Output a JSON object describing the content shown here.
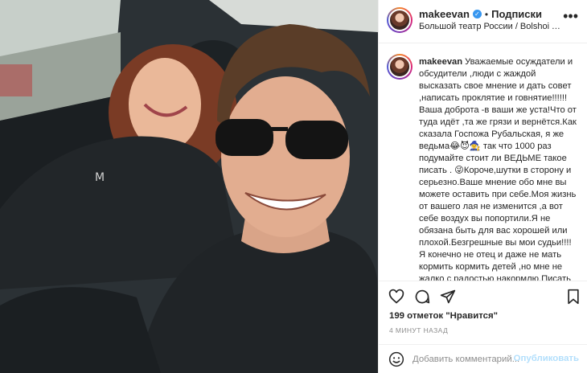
{
  "post": {
    "username": "makeevan",
    "verified_mark": "✓",
    "separator": "•",
    "follow_label": "Подписки",
    "location": "Большой театр России / Bolshoi Theatre Russia",
    "more_icon": "more-horizontal-icon"
  },
  "caption": {
    "username": "makeevan",
    "text": "Уважаемые осуждатели и обсудители ,люди с жаждой высказать свое мнение и дать совет ,написать проклятие и говнятие!!!!!! Ваша доброта -в ваши же уста!Что от туда идёт ,та же грязи и вернётся.Как сказала Госпожа Рубальская, я же ведьма😂😈🧙‍♀️ так что 1000 раз подумайте стоит ли ВЕДЬМЕ такое писать . 😜Короче,шутки в сторону и серьезно.Ваше мнение обо мне вы можете оставить при себе.Моя жизнь от вашего лая не изменится ,а вот себе воздух вы попортили.Я не обязана быть для вас хорошей или плохой.Безгрешные вы мои судьи!!!! Я конечно не отец и даже не мать кормить кормить детей ,но мне не жалко с радостью накормлю.Писать мне про сорвать маленьких или..."
  },
  "actions": {
    "icons": [
      "heart-icon",
      "comment-icon",
      "share-icon",
      "bookmark-icon"
    ]
  },
  "likes_text": "199 отметок \"Нравится\"",
  "time_text": "4 МИНУТ НАЗАД",
  "comment": {
    "placeholder": "Добавить комментарий...",
    "publish_label": "Опубликовать",
    "emoji_icon": "emoji-icon"
  },
  "colors": {
    "verified": "#3897f0",
    "publish_disabled": "#b2dffc",
    "muted": "#8e8e8e",
    "border": "#efefef"
  }
}
